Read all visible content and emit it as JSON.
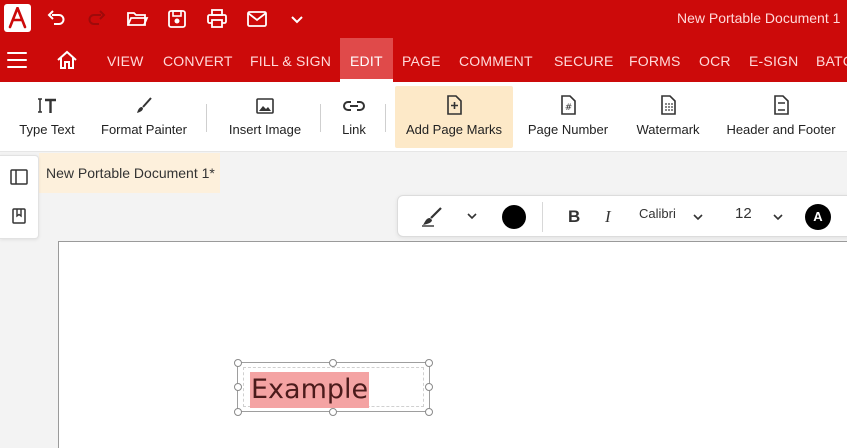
{
  "app": {
    "document_title": "New Portable Document 1"
  },
  "menu": {
    "tabs": [
      {
        "label": "VIEW"
      },
      {
        "label": "CONVERT"
      },
      {
        "label": "FILL & SIGN"
      },
      {
        "label": "EDIT",
        "active": true
      },
      {
        "label": "PAGE"
      },
      {
        "label": "COMMENT"
      },
      {
        "label": "SECURE"
      },
      {
        "label": "FORMS"
      },
      {
        "label": "OCR"
      },
      {
        "label": "E-SIGN"
      },
      {
        "label": "BATC"
      }
    ]
  },
  "ribbon": {
    "type_text": "Type Text",
    "format_painter": "Format Painter",
    "insert_image": "Insert Image",
    "link": "Link",
    "add_page_marks": "Add Page Marks",
    "page_number": "Page Number",
    "watermark": "Watermark",
    "header_footer": "Header and Footer"
  },
  "document_tab": {
    "label": "New Portable Document 1*"
  },
  "format_toolbar": {
    "text_color": "#000000",
    "font": "Calibri",
    "size": "12",
    "font_color_letter": "A"
  },
  "page": {
    "text_box": "Example",
    "highlight_color": "#f4a3a3"
  },
  "colors": {
    "brand": "#cc0a0a",
    "active_tab": "#e04a4a",
    "ribbon_highlight": "#fde9c8"
  }
}
